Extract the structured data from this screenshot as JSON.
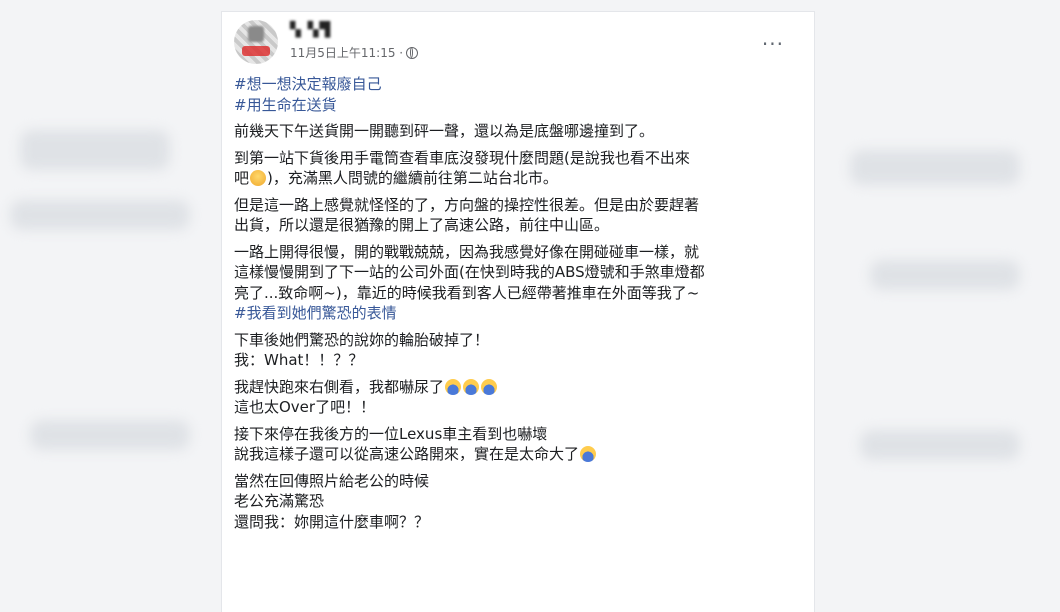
{
  "post": {
    "author": "▚ ▚▜",
    "timestamp": "11月5日上午11:15 ·",
    "more_label": "···",
    "hashtags_top": [
      "#想一想決定報廢自己",
      "#用生命在送貨"
    ],
    "paragraphs": [
      [
        "前幾天下午送貨開一開聽到砰一聲，還以為是底盤哪邊撞到了。"
      ],
      [
        "到第一站下貨後用手電筒查看車底沒發現什麼問題(是說我也看不出來",
        "吧",
        "emoji:yellow",
        ")，充滿黑人問號的繼續前往第二站台北市。"
      ],
      [
        "但是這一路上感覺就怪怪的了，方向盤的操控性很差。但是由於要趕著",
        "出貨，所以還是很猶豫的開上了高速公路，前往中山區。"
      ],
      [
        "一路上開得很慢，開的戰戰兢兢，因為我感覺好像在開碰碰車一樣，就",
        "這樣慢慢開到了下一站的公司外面(在快到時我的ABS燈號和手煞車燈都",
        "亮了...致命啊~)，靠近的時候我看到客人已經帶著推車在外面等我了~"
      ]
    ],
    "hashtag_mid": "#我看到她們驚恐的表情",
    "paragraphs2": [
      [
        "下車後她們驚恐的說妳的輪胎破掉了！",
        "我：What！！？？"
      ],
      [
        "我趕快跑來右側看，我都嚇尿了",
        "這也太Over了吧！！"
      ],
      [
        "接下來停在我後方的一位Lexus車主看到也嚇壞",
        "說我這樣子還可以從高速公路開來，實在是太命大了"
      ],
      [
        "當然在回傳照片給老公的時候",
        "老公充滿驚恐",
        "還問我：妳開這什麼車啊？？"
      ]
    ]
  }
}
